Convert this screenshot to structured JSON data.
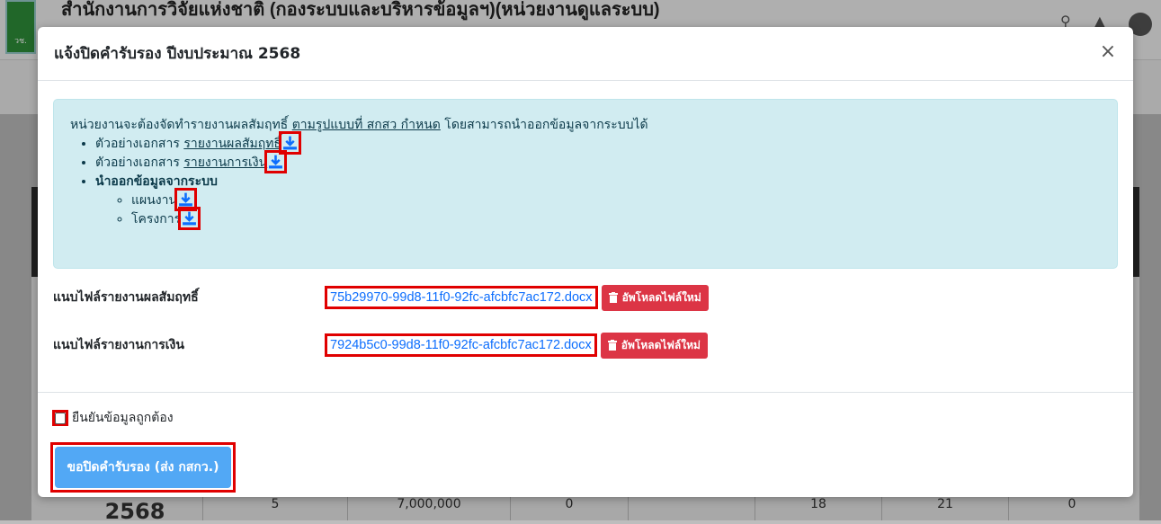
{
  "background": {
    "org_title": "สำนักงานการวิจัยแห่งชาติ (กองระบบและบริหารข้อมูลฯ)(หน่วยงานดูแลระบบ)",
    "logo_text": "วช.",
    "table_row": {
      "year": "2568",
      "cells": [
        "5",
        "7,000,000",
        "0",
        "",
        "18",
        "21",
        "0"
      ]
    }
  },
  "modal": {
    "title": "แจ้งปิดคำรับรอง ปีงบประมาณ 2568",
    "close_label": "×",
    "info": {
      "intro_prefix": "หน่วยงานจะต้องจัดทำรายงานผลสัมฤทธิ์ ",
      "intro_link": "ตามรูปแบบที่ สกสว กำหนด",
      "intro_suffix": " โดยสามารถนำออกข้อมูลจากระบบได้",
      "items": [
        {
          "prefix": "ตัวอย่างเอกสาร ",
          "link": "รายงานผลสัมฤทธิ์"
        },
        {
          "prefix": "ตัวอย่างเอกสาร ",
          "link": "รายงานการเงิน"
        }
      ],
      "export_heading": "นำออกข้อมูลจากระบบ",
      "export_items": [
        "แผนงาน",
        "โครงการ"
      ]
    },
    "files": [
      {
        "label": "แนบไฟล์รายงานผลสัมฤทธิ์",
        "filename": "75b29970-99d8-11f0-92fc-afcbfc7ac172.docx",
        "button": "อัพโหลดไฟล์ใหม่"
      },
      {
        "label": "แนบไฟล์รายงานการเงิน",
        "filename": "7924b5c0-99d8-11f0-92fc-afcbfc7ac172.docx",
        "button": "อัพโหลดไฟล์ใหม่"
      }
    ],
    "confirm_label": "ยืนยันข้อมูลถูกต้อง",
    "submit_label": "ขอปิดคำรับรอง (ส่ง กสกว.)"
  },
  "colors": {
    "info_bg": "#d1ecf1",
    "link_blue": "#0d6efd",
    "danger": "#dc3545",
    "primary_btn": "#52a8f5",
    "highlight": "#e00000"
  }
}
